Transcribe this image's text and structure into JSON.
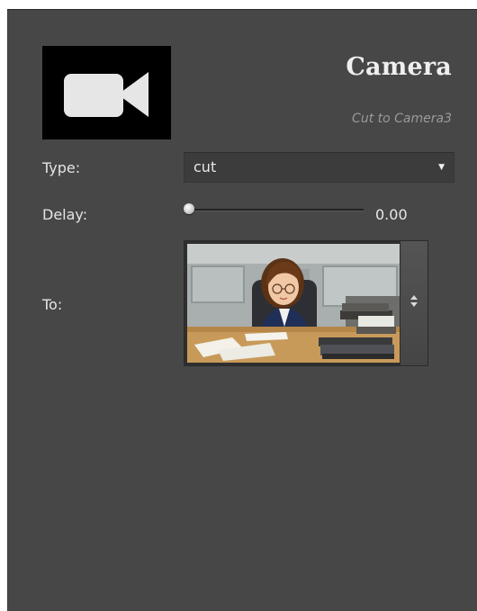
{
  "panel": {
    "title": "Camera",
    "subtitle": "Cut to Camera3",
    "icon": "video-camera-icon"
  },
  "fields": {
    "type_label": "Type:",
    "type_value": "cut",
    "delay_label": "Delay:",
    "delay_value": "0.00",
    "delay_fraction": 0.0,
    "to_label": "To:",
    "to_preview": "camera3-thumbnail"
  },
  "colors": {
    "panel_bg": "#474747",
    "text": "#e4e4e4",
    "subtitle": "#9a9a9a"
  }
}
